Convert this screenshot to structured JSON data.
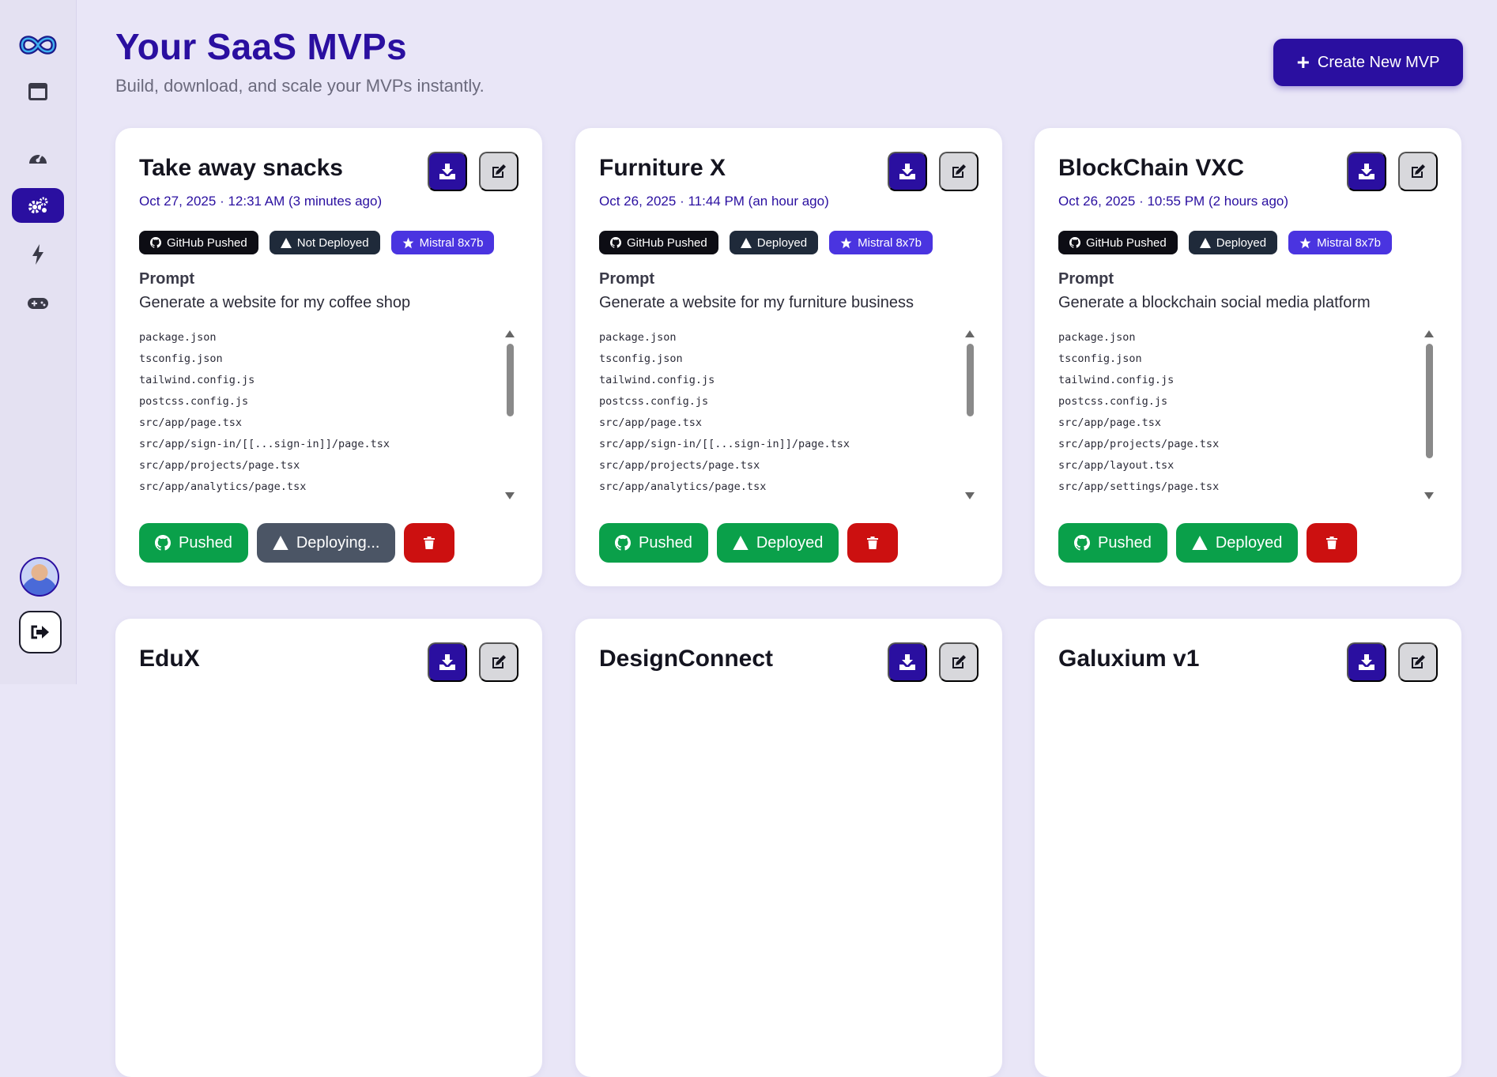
{
  "header": {
    "title": "Your SaaS MVPs",
    "subtitle": "Build, download, and scale your MVPs instantly.",
    "create_label": "Create New MVP"
  },
  "sidebar": {
    "items": [
      {
        "icon": "dashboard-icon"
      },
      {
        "icon": "gauge-icon"
      },
      {
        "icon": "settings-cogs-icon",
        "active": true
      },
      {
        "icon": "lightning-icon"
      },
      {
        "icon": "gamepad-icon"
      }
    ]
  },
  "colors": {
    "brand": "#2a0fa0",
    "success": "#0aa04a",
    "danger": "#cc1010"
  },
  "cards": [
    {
      "title": "Take away snacks",
      "date": "Oct 27, 2025 · 12:31 AM  (3 minutes ago)",
      "badge_github": "GitHub Pushed",
      "badge_deploy": "Not Deployed",
      "badge_model": "Mistral 8x7b",
      "prompt_label": "Prompt",
      "prompt": "Generate a website for my coffee shop",
      "files": [
        "package.json",
        "tsconfig.json",
        "tailwind.config.js",
        "postcss.config.js",
        "src/app/page.tsx",
        "src/app/sign-in/[[...sign-in]]/page.tsx",
        "src/app/projects/page.tsx",
        "src/app/analytics/page.tsx"
      ],
      "push_label": "Pushed",
      "deploy_label": "Deploying...",
      "deploy_state": "deploying"
    },
    {
      "title": "Furniture X",
      "date": "Oct 26, 2025 · 11:44 PM  (an hour ago)",
      "badge_github": "GitHub Pushed",
      "badge_deploy": "Deployed",
      "badge_model": "Mistral 8x7b",
      "prompt_label": "Prompt",
      "prompt": "Generate a website for my furniture business",
      "files": [
        "package.json",
        "tsconfig.json",
        "tailwind.config.js",
        "postcss.config.js",
        "src/app/page.tsx",
        "src/app/sign-in/[[...sign-in]]/page.tsx",
        "src/app/projects/page.tsx",
        "src/app/analytics/page.tsx"
      ],
      "push_label": "Pushed",
      "deploy_label": "Deployed",
      "deploy_state": "deployed"
    },
    {
      "title": "BlockChain VXC",
      "date": "Oct 26, 2025 · 10:55 PM  (2 hours ago)",
      "badge_github": "GitHub Pushed",
      "badge_deploy": "Deployed",
      "badge_model": "Mistral 8x7b",
      "prompt_label": "Prompt",
      "prompt": "Generate a blockchain social media platform",
      "files": [
        "package.json",
        "tsconfig.json",
        "tailwind.config.js",
        "postcss.config.js",
        "src/app/page.tsx",
        "src/app/projects/page.tsx",
        "src/app/layout.tsx",
        "src/app/settings/page.tsx"
      ],
      "push_label": "Pushed",
      "deploy_label": "Deployed",
      "deploy_state": "deployed"
    },
    {
      "title": "EduX"
    },
    {
      "title": "DesignConnect"
    },
    {
      "title": "Galuxium v1"
    }
  ]
}
